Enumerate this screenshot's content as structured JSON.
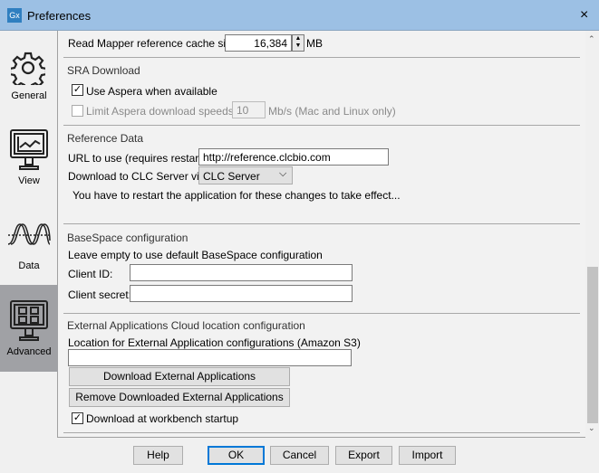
{
  "window": {
    "title": "Preferences",
    "app_icon": "Gx",
    "close_icon": "×"
  },
  "sidebar": {
    "items": [
      {
        "label": "General",
        "icon": "gear-icon"
      },
      {
        "label": "View",
        "icon": "monitor-chart-icon"
      },
      {
        "label": "Data",
        "icon": "waves-icon"
      },
      {
        "label": "Advanced",
        "icon": "monitor-checkbox-icon",
        "selected": true
      }
    ]
  },
  "main": {
    "cache_label": "Read Mapper reference cache size:",
    "cache_value": "16,384",
    "cache_unit": "MB",
    "sra": {
      "heading": "SRA Download",
      "use_aspera": "Use Aspera when available",
      "use_aspera_checked": true,
      "limit": "Limit Aspera download speeds to",
      "limit_checked": false,
      "limit_value": "10",
      "limit_unit": "Mb/s (Mac and Linux only)"
    },
    "ref": {
      "heading": "Reference Data",
      "url_label": "URL to use (requires restart):",
      "url_value": "http://reference.clcbio.com",
      "download_label": "Download to CLC Server via",
      "download_value": "CLC Server",
      "note": "You have to restart the application for these changes to take effect..."
    },
    "basespace": {
      "heading": "BaseSpace configuration",
      "hint": "Leave empty to use default BaseSpace configuration",
      "client_id_label": "Client ID:",
      "client_id_value": "",
      "client_secret_label": "Client secret:",
      "client_secret_value": ""
    },
    "external": {
      "heading": "External Applications Cloud location configuration",
      "location_label": "Location for External Application configurations (Amazon S3)",
      "location_value": "",
      "download_btn": "Download External Applications",
      "remove_btn": "Remove Downloaded External Applications",
      "startup": "Download at workbench startup",
      "startup_checked": true
    }
  },
  "footer": {
    "help": "Help",
    "ok": "OK",
    "cancel": "Cancel",
    "export": "Export",
    "import": "Import"
  }
}
